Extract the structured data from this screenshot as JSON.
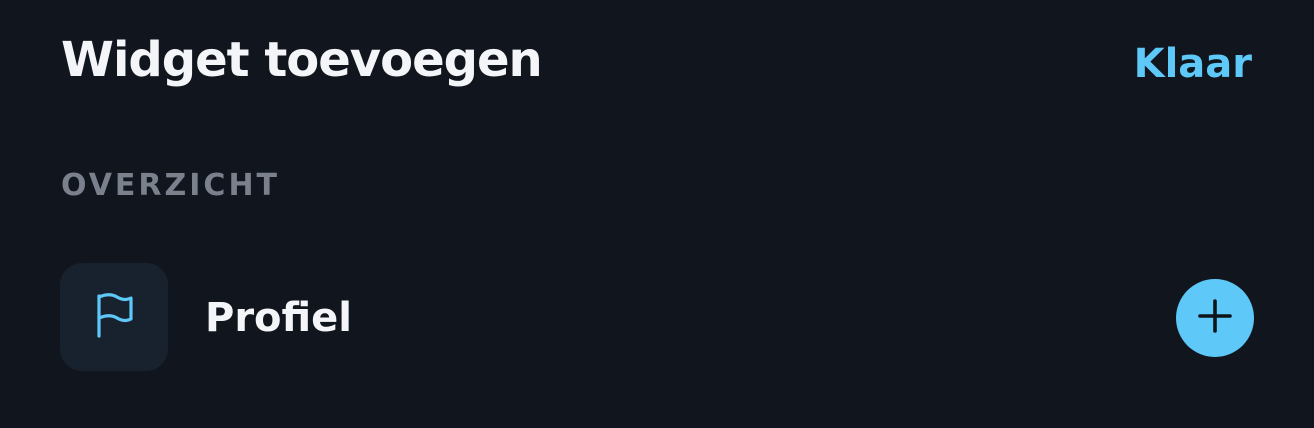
{
  "header": {
    "title": "Widget toevoegen",
    "done_label": "Klaar"
  },
  "section": {
    "label": "OVERZICHT"
  },
  "items": [
    {
      "label": "Profiel",
      "icon": "flag-icon",
      "action_icon": "plus-icon"
    }
  ],
  "colors": {
    "background": "#11151d",
    "accent": "#5ec8f8",
    "tile": "#18222e",
    "section_label": "#7a818d",
    "text": "#f3f5f8"
  }
}
